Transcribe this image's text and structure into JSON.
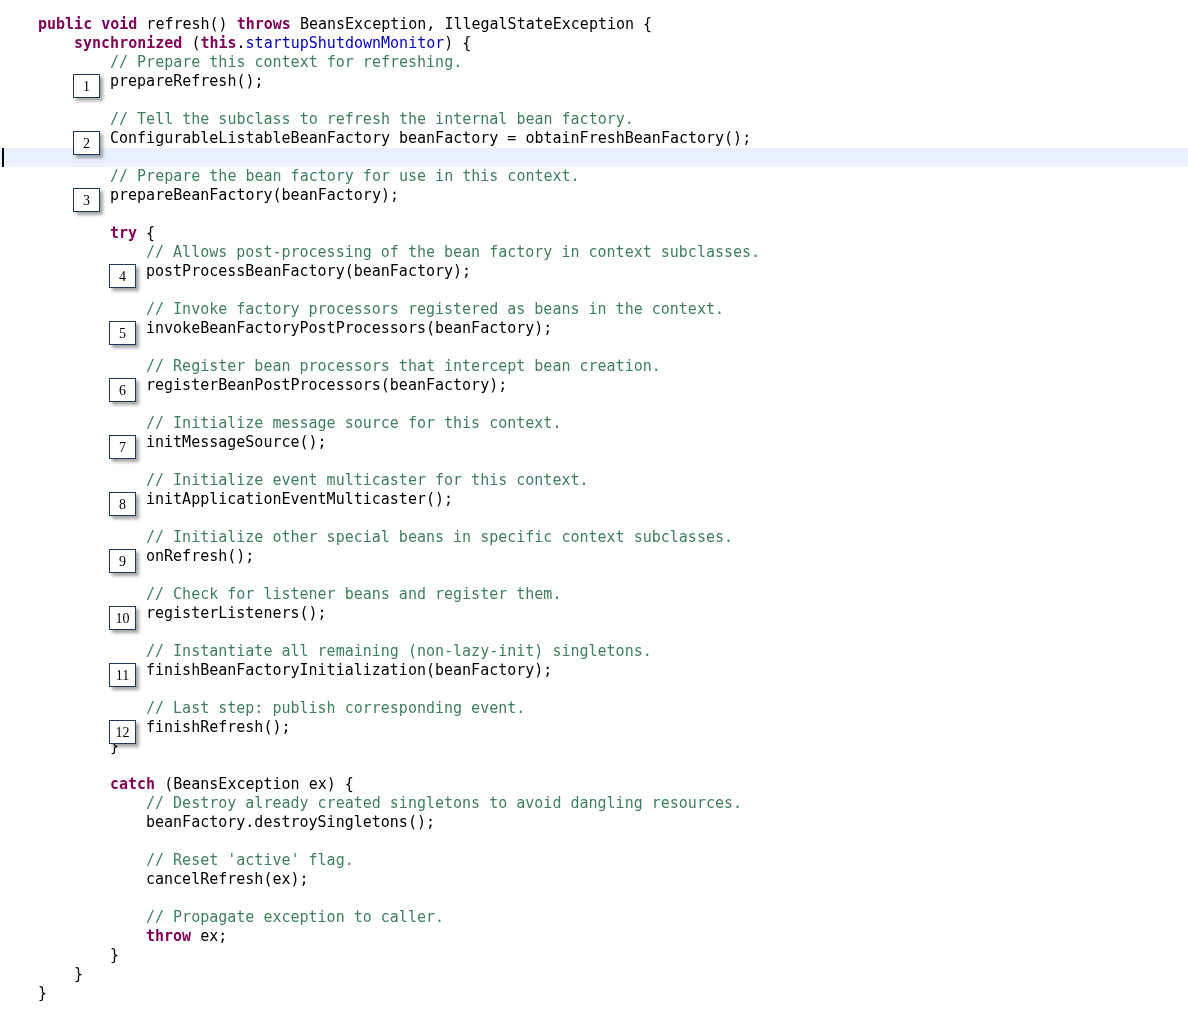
{
  "lines": [
    {
      "kind": "code",
      "segments": [
        {
          "kind": "keyword",
          "text": "public void"
        },
        {
          "kind": "plain",
          "text": " refresh() "
        },
        {
          "kind": "keyword",
          "text": "throws"
        },
        {
          "kind": "plain",
          "text": " BeansException, IllegalStateException {"
        }
      ],
      "children": [
        {
          "kind": "code",
          "segments": [
            {
              "kind": "keyword",
              "text": "synchronized"
            },
            {
              "kind": "plain",
              "text": " ("
            },
            {
              "kind": "keyword",
              "text": "this"
            },
            {
              "kind": "plain",
              "text": "."
            },
            {
              "kind": "field",
              "text": "startupShutdownMonitor"
            },
            {
              "kind": "plain",
              "text": ") {"
            }
          ],
          "children": [
            {
              "kind": "code",
              "segments": [
                {
                  "kind": "comment",
                  "text": "// Prepare this context for refreshing."
                }
              ]
            },
            {
              "kind": "code",
              "callout": "1",
              "segments": [
                {
                  "kind": "plain",
                  "text": "prepareRefresh();"
                }
              ]
            },
            {
              "kind": "blank"
            },
            {
              "kind": "code",
              "segments": [
                {
                  "kind": "comment",
                  "text": "// Tell the subclass to refresh the internal bean factory."
                }
              ]
            },
            {
              "kind": "code",
              "callout": "2",
              "segments": [
                {
                  "kind": "plain",
                  "text": "ConfigurableListableBeanFactory beanFactory = obtainFreshBeanFactory();"
                }
              ]
            },
            {
              "kind": "blank",
              "current": true
            },
            {
              "kind": "code",
              "segments": [
                {
                  "kind": "comment",
                  "text": "// Prepare the bean factory for use in this context."
                }
              ]
            },
            {
              "kind": "code",
              "callout": "3",
              "segments": [
                {
                  "kind": "plain",
                  "text": "prepareBeanFactory(beanFactory);"
                }
              ]
            },
            {
              "kind": "blank"
            },
            {
              "kind": "code",
              "segments": [
                {
                  "kind": "keyword",
                  "text": "try"
                },
                {
                  "kind": "plain",
                  "text": " {"
                }
              ],
              "children": [
                {
                  "kind": "code",
                  "segments": [
                    {
                      "kind": "comment",
                      "text": "// Allows post-processing of the bean factory in context subclasses."
                    }
                  ]
                },
                {
                  "kind": "code",
                  "callout": "4",
                  "segments": [
                    {
                      "kind": "plain",
                      "text": "postProcessBeanFactory(beanFactory);"
                    }
                  ]
                },
                {
                  "kind": "blank"
                },
                {
                  "kind": "code",
                  "segments": [
                    {
                      "kind": "comment",
                      "text": "// Invoke factory processors registered as beans in the context."
                    }
                  ]
                },
                {
                  "kind": "code",
                  "callout": "5",
                  "segments": [
                    {
                      "kind": "plain",
                      "text": "invokeBeanFactoryPostProcessors(beanFactory);"
                    }
                  ]
                },
                {
                  "kind": "blank"
                },
                {
                  "kind": "code",
                  "segments": [
                    {
                      "kind": "comment",
                      "text": "// Register bean processors that intercept bean creation."
                    }
                  ]
                },
                {
                  "kind": "code",
                  "callout": "6",
                  "segments": [
                    {
                      "kind": "plain",
                      "text": "registerBeanPostProcessors(beanFactory);"
                    }
                  ]
                },
                {
                  "kind": "blank"
                },
                {
                  "kind": "code",
                  "segments": [
                    {
                      "kind": "comment",
                      "text": "// Initialize message source for this context."
                    }
                  ]
                },
                {
                  "kind": "code",
                  "callout": "7",
                  "segments": [
                    {
                      "kind": "plain",
                      "text": "initMessageSource();"
                    }
                  ]
                },
                {
                  "kind": "blank"
                },
                {
                  "kind": "code",
                  "segments": [
                    {
                      "kind": "comment",
                      "text": "// Initialize event multicaster for this context."
                    }
                  ]
                },
                {
                  "kind": "code",
                  "callout": "8",
                  "segments": [
                    {
                      "kind": "plain",
                      "text": "initApplicationEventMulticaster();"
                    }
                  ]
                },
                {
                  "kind": "blank"
                },
                {
                  "kind": "code",
                  "segments": [
                    {
                      "kind": "comment",
                      "text": "// Initialize other special beans in specific context subclasses."
                    }
                  ]
                },
                {
                  "kind": "code",
                  "callout": "9",
                  "segments": [
                    {
                      "kind": "plain",
                      "text": "onRefresh();"
                    }
                  ]
                },
                {
                  "kind": "blank"
                },
                {
                  "kind": "code",
                  "segments": [
                    {
                      "kind": "comment",
                      "text": "// Check for listener beans and register them."
                    }
                  ]
                },
                {
                  "kind": "code",
                  "callout": "10",
                  "segments": [
                    {
                      "kind": "plain",
                      "text": "registerListeners();"
                    }
                  ]
                },
                {
                  "kind": "blank"
                },
                {
                  "kind": "code",
                  "segments": [
                    {
                      "kind": "comment",
                      "text": "// Instantiate all remaining (non-lazy-init) singletons."
                    }
                  ]
                },
                {
                  "kind": "code",
                  "callout": "11",
                  "segments": [
                    {
                      "kind": "plain",
                      "text": "finishBeanFactoryInitialization(beanFactory);"
                    }
                  ]
                },
                {
                  "kind": "blank"
                },
                {
                  "kind": "code",
                  "segments": [
                    {
                      "kind": "comment",
                      "text": "// Last step: publish corresponding event."
                    }
                  ]
                },
                {
                  "kind": "code",
                  "callout": "12",
                  "segments": [
                    {
                      "kind": "plain",
                      "text": "finishRefresh();"
                    }
                  ]
                }
              ]
            },
            {
              "kind": "code",
              "segments": [
                {
                  "kind": "plain",
                  "text": "}"
                }
              ]
            },
            {
              "kind": "blank"
            },
            {
              "kind": "code",
              "segments": [
                {
                  "kind": "keyword",
                  "text": "catch"
                },
                {
                  "kind": "plain",
                  "text": " (BeansException ex) {"
                }
              ],
              "children": [
                {
                  "kind": "code",
                  "segments": [
                    {
                      "kind": "comment",
                      "text": "// Destroy already created singletons to avoid dangling resources."
                    }
                  ]
                },
                {
                  "kind": "code",
                  "segments": [
                    {
                      "kind": "plain",
                      "text": "beanFactory.destroySingletons();"
                    }
                  ]
                },
                {
                  "kind": "blank"
                },
                {
                  "kind": "code",
                  "segments": [
                    {
                      "kind": "comment",
                      "text": "// Reset 'active' flag."
                    }
                  ]
                },
                {
                  "kind": "code",
                  "segments": [
                    {
                      "kind": "plain",
                      "text": "cancelRefresh(ex);"
                    }
                  ]
                },
                {
                  "kind": "blank"
                },
                {
                  "kind": "code",
                  "segments": [
                    {
                      "kind": "comment",
                      "text": "// Propagate exception to caller."
                    }
                  ]
                },
                {
                  "kind": "code",
                  "segments": [
                    {
                      "kind": "keyword",
                      "text": "throw"
                    },
                    {
                      "kind": "plain",
                      "text": " ex;"
                    }
                  ]
                }
              ]
            },
            {
              "kind": "code",
              "segments": [
                {
                  "kind": "plain",
                  "text": "}"
                }
              ]
            }
          ]
        },
        {
          "kind": "code",
          "segments": [
            {
              "kind": "plain",
              "text": "}"
            }
          ]
        }
      ]
    },
    {
      "kind": "code",
      "segments": [
        {
          "kind": "plain",
          "text": "}"
        }
      ]
    }
  ]
}
